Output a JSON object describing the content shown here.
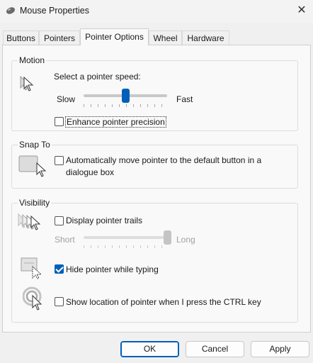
{
  "window": {
    "title": "Mouse Properties",
    "close_glyph": "✕",
    "icon": "mouse-icon"
  },
  "tabs": [
    {
      "label": "Buttons"
    },
    {
      "label": "Pointers"
    },
    {
      "label": "Pointer Options",
      "active": true
    },
    {
      "label": "Wheel"
    },
    {
      "label": "Hardware"
    }
  ],
  "motion": {
    "group_label": "Motion",
    "speed_label": "Select a pointer speed:",
    "slow_label": "Slow",
    "fast_label": "Fast",
    "speed_value_fraction": 0.5,
    "enhance_label": "Enhance pointer precision",
    "enhance_checked": false,
    "icon": "pointer-speed-icon"
  },
  "snap_to": {
    "group_label": "Snap To",
    "auto_move_label_line1": "Automatically move pointer to the default button in a",
    "auto_move_label_line2": "dialogue box",
    "auto_move_checked": false,
    "icon": "snap-to-default-icon"
  },
  "visibility": {
    "group_label": "Visibility",
    "trails_label": "Display pointer trails",
    "trails_checked": false,
    "short_label": "Short",
    "long_label": "Long",
    "trail_length_fraction": 1.0,
    "hide_typing_label": "Hide pointer while typing",
    "hide_typing_checked": true,
    "show_location_label": "Show location of pointer when I press the CTRL key",
    "show_location_checked": false
  },
  "buttons": {
    "ok": "OK",
    "cancel": "Cancel",
    "apply": "Apply"
  },
  "colors": {
    "accent": "#005fb8",
    "disabled_text": "#a0a0a0",
    "panel": "#f9f9f9",
    "window": "#f0f0f0"
  }
}
